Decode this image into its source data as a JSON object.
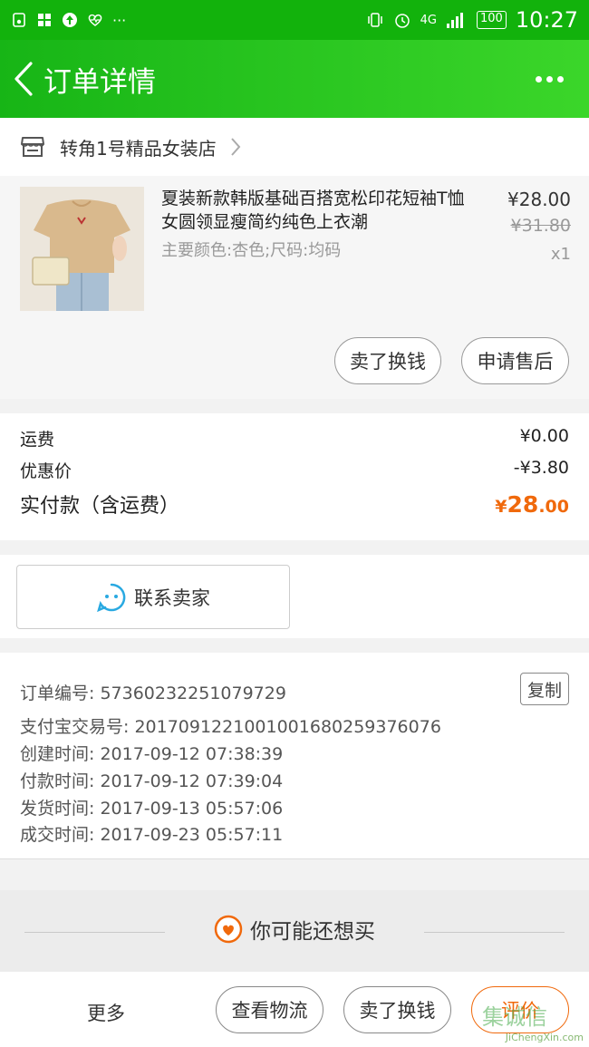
{
  "status_bar": {
    "time": "10:27",
    "network": "4G",
    "battery": "100",
    "dots": "···"
  },
  "title_bar": {
    "title": "订单详情"
  },
  "shop": {
    "name": "转角1号精品女装店"
  },
  "product": {
    "title": "夏装新款韩版基础百搭宽松印花短袖T恤女圆领显瘦简约纯色上衣潮",
    "spec": "主要颜色:杏色;尺码:均码",
    "price": "¥28.00",
    "original_price": "¥31.80",
    "quantity": "x1",
    "actions": [
      "卖了换钱",
      "申请售后"
    ]
  },
  "fees": {
    "shipping_label": "运费",
    "shipping_value": "¥0.00",
    "discount_label": "优惠价",
    "discount_value": "-¥3.80",
    "total_label": "实付款（含运费）",
    "total_currency": "¥",
    "total_integer": "28",
    "total_decimal": ".00"
  },
  "contact": {
    "label": "联系卖家"
  },
  "order_info": {
    "order_no": "订单编号: 57360232251079729",
    "alipay_no": "支付宝交易号: 2017091221001001680259376076",
    "created": "创建时间: 2017-09-12 07:38:39",
    "paid": "付款时间: 2017-09-12 07:39:04",
    "shipped": "发货时间: 2017-09-13 05:57:06",
    "completed": "成交时间: 2017-09-23 05:57:11",
    "copy_label": "复制"
  },
  "maybe_buy": {
    "label": "你可能还想买"
  },
  "bottom_bar": {
    "more": "更多",
    "logistics": "查看物流",
    "resell": "卖了换钱",
    "rate": "评价"
  },
  "watermark": {
    "text": "JiChengXin.com",
    "logo": "集诚信"
  },
  "colors": {
    "header_green": "#12b20c",
    "price_orange": "#f0690c"
  }
}
